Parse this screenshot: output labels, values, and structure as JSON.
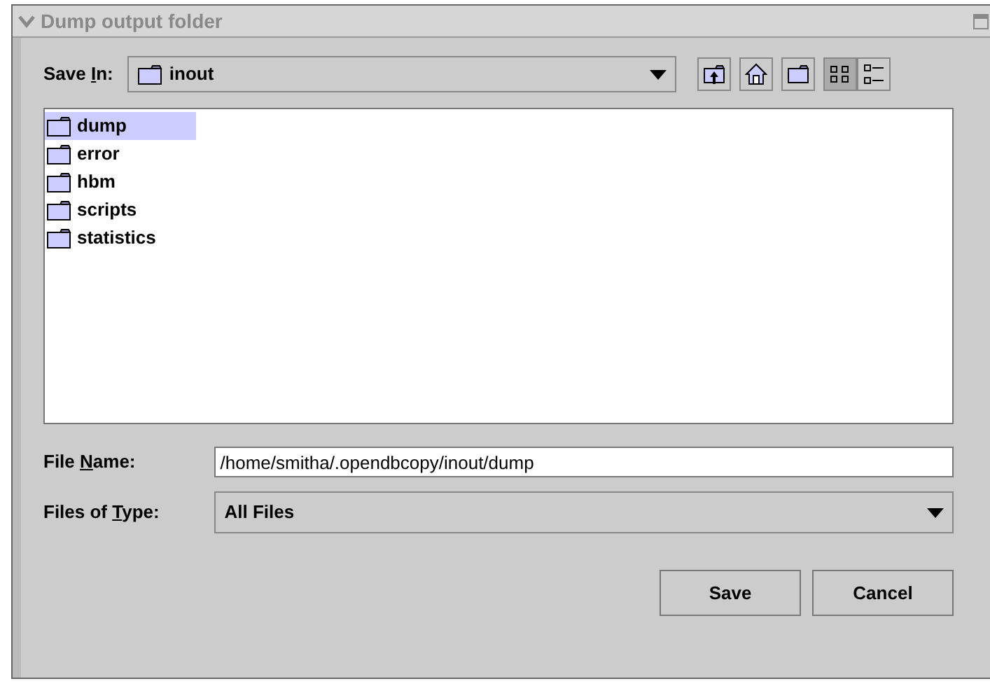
{
  "window": {
    "title": "Dump output folder"
  },
  "save_in": {
    "label": {
      "before": "Save ",
      "key": "I",
      "after": "n:"
    },
    "value": "inout"
  },
  "toolbar": [
    {
      "kind": "up",
      "selected": false
    },
    {
      "kind": "home",
      "selected": false
    },
    {
      "kind": "new-folder",
      "selected": false
    },
    {
      "kind": "list",
      "selected": true
    },
    {
      "kind": "details",
      "selected": false
    }
  ],
  "files": [
    {
      "name": "dump",
      "selected": true
    },
    {
      "name": "error",
      "selected": false
    },
    {
      "name": "hbm",
      "selected": false
    },
    {
      "name": "scripts",
      "selected": false
    },
    {
      "name": "statistics",
      "selected": false
    }
  ],
  "file_name": {
    "label": {
      "before": "File ",
      "key": "N",
      "after": "ame:"
    },
    "value": "/home/smitha/.opendbcopy/inout/dump"
  },
  "file_type": {
    "label": {
      "before": "Files of ",
      "key": "T",
      "after": "ype:"
    },
    "value": "All Files"
  },
  "buttons": [
    "Save",
    "Cancel"
  ]
}
